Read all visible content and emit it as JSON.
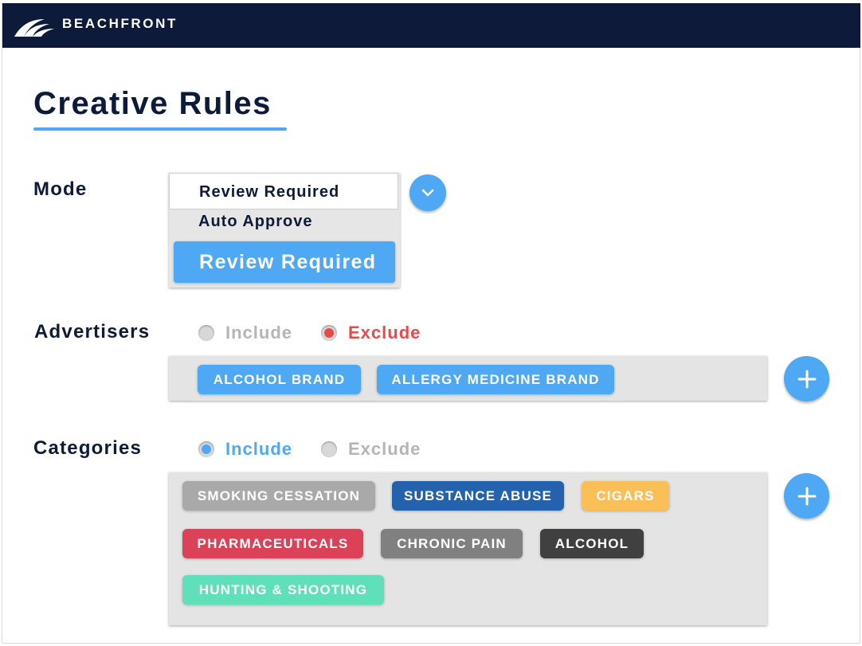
{
  "header": {
    "brand": "BEACHFRONT",
    "logo_icon": "wave-logo-icon",
    "background": "#0d1a3a"
  },
  "page": {
    "title": "Creative Rules"
  },
  "mode": {
    "label": "Mode",
    "current_value": "Review Required",
    "options": [
      "Auto Approve",
      "Review Required"
    ],
    "selected_option": "Review Required",
    "toggle_icon": "chevron-down-icon"
  },
  "advertisers": {
    "label": "Advertisers",
    "include_label": "Include",
    "exclude_label": "Exclude",
    "selected": "Exclude",
    "tags": [
      {
        "label": "ALCOHOL BRAND",
        "color": "#4ea8f4"
      },
      {
        "label": "ALLERGY MEDICINE BRAND",
        "color": "#4ea8f4"
      }
    ],
    "add_icon": "plus-icon"
  },
  "categories": {
    "label": "Categories",
    "include_label": "Include",
    "exclude_label": "Exclude",
    "selected": "Include",
    "tags": [
      {
        "label": "SMOKING CESSATION",
        "color": "#a9a9a9"
      },
      {
        "label": "SUBSTANCE ABUSE",
        "color": "#2462ad"
      },
      {
        "label": "CIGARS",
        "color": "#fbbf57"
      },
      {
        "label": "PHARMACEUTICALS",
        "color": "#db4157"
      },
      {
        "label": "CHRONIC PAIN",
        "color": "#808080"
      },
      {
        "label": "ALCOHOL",
        "color": "#404040"
      },
      {
        "label": "HUNTING & SHOOTING",
        "color": "#5fdfba"
      }
    ],
    "add_icon": "plus-icon"
  },
  "colors": {
    "accent": "#4ea8f4",
    "exclude_active": "#e84a4a",
    "inactive": "#b5b5b5",
    "text_dark": "#0d1a3a"
  }
}
